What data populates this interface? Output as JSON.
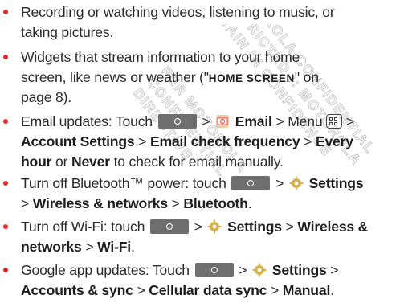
{
  "watermark": {
    "lines": [
      "MOTOROLA CONFIDENTIAL",
      "RESTRICTED :: MOTOROLA",
      "RETAIN IN CONFIDENCE",
      "PER MOTOROLA",
      "CONFIDENTIAL",
      "DIRECTIVE"
    ]
  },
  "items": [
    {
      "t1": "Recording or watching videos, listening to music, or",
      "t2": "taking pictures."
    },
    {
      "t1": "Widgets that stream information to your home",
      "t2a": "screen, like news or weather (\"",
      "t2sc": "HOME SCREEN",
      "t2b": "\" on",
      "t3": "page 8)."
    },
    {
      "a": "Email updates: Touch",
      "gt1": ">",
      "email": "Email",
      "gt2": "> Menu",
      "gt3": ">",
      "account": "Account Settings",
      "gt4": ">",
      "freq": "Email check frequency",
      "gt5": ">",
      "every": "Every",
      "hour": "hour",
      "or": "or",
      "never": "Never",
      "tail": "to check for email manually."
    },
    {
      "a": "Turn off Bluetooth™ power: touch",
      "gt1": ">",
      "settings": "Settings",
      "gt2": ">",
      "wireless": "Wireless & networks",
      "gt3": ">",
      "bluetooth": "Bluetooth",
      "dot": "."
    },
    {
      "a": "Turn off Wi-Fi: touch",
      "gt1": ">",
      "settings": "Settings",
      "gt2": ">",
      "wireless": "Wireless &",
      "networks": "networks",
      "gt3": ">",
      "wifi": "Wi-Fi",
      "dot": "."
    },
    {
      "a": "Google app updates: Touch",
      "gt1": ">",
      "settings": "Settings",
      "gt2": ">",
      "accounts": "Accounts & sync",
      "gt3": ">",
      "cellular": "Cellular data sync",
      "gt4": ">",
      "manual": "Manual",
      "dot": "."
    }
  ]
}
